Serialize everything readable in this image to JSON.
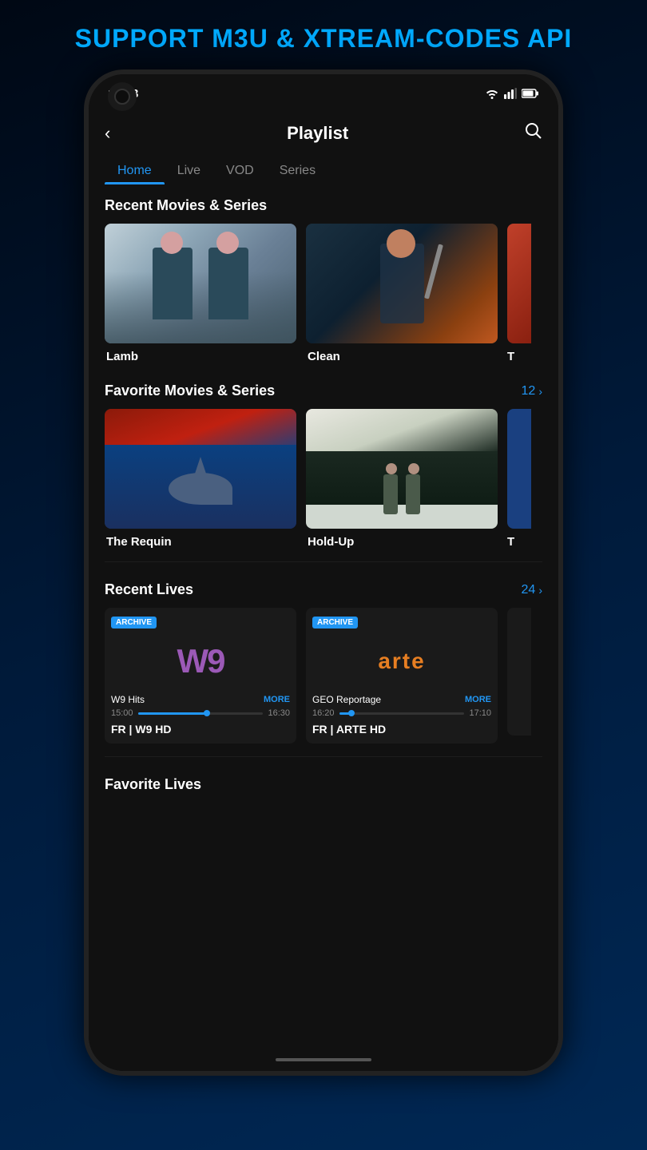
{
  "page": {
    "top_title": "SUPPORT M3U & XTREAM-CODES API",
    "status": {
      "time": "16:23"
    },
    "app_bar": {
      "title": "Playlist",
      "back_label": "‹",
      "search_label": "⌕"
    },
    "tabs": [
      {
        "id": "home",
        "label": "Home",
        "active": true
      },
      {
        "id": "live",
        "label": "Live",
        "active": false
      },
      {
        "id": "vod",
        "label": "VOD",
        "active": false
      },
      {
        "id": "series",
        "label": "Series",
        "active": false
      }
    ],
    "recent_movies": {
      "title": "Recent Movies & Series",
      "items": [
        {
          "id": "lamb",
          "title": "Lamb"
        },
        {
          "id": "clean",
          "title": "Clean"
        },
        {
          "id": "partial",
          "title": "T"
        }
      ]
    },
    "favorite_movies": {
      "title": "Favorite Movies & Series",
      "count": "12",
      "chevron": "›",
      "items": [
        {
          "id": "requin",
          "title": "The Requin"
        },
        {
          "id": "holdup",
          "title": "Hold-Up"
        },
        {
          "id": "partial",
          "title": "T"
        }
      ]
    },
    "recent_lives": {
      "title": "Recent Lives",
      "count": "24",
      "chevron": "›",
      "items": [
        {
          "id": "w9",
          "badge": "ARCHIVE",
          "logo": "W9",
          "program": "W9 Hits",
          "more": "MORE",
          "time_start": "15:00",
          "time_end": "16:30",
          "progress": 55,
          "channel": "FR | W9 HD"
        },
        {
          "id": "arte",
          "badge": "ARCHIVE",
          "logo": "arte",
          "program": "GEO Reportage",
          "more": "MORE",
          "time_start": "16:20",
          "time_end": "17:10",
          "progress": 10,
          "channel": "FR | ARTE HD"
        }
      ]
    },
    "favorite_lives": {
      "title": "Favorite Lives"
    }
  }
}
